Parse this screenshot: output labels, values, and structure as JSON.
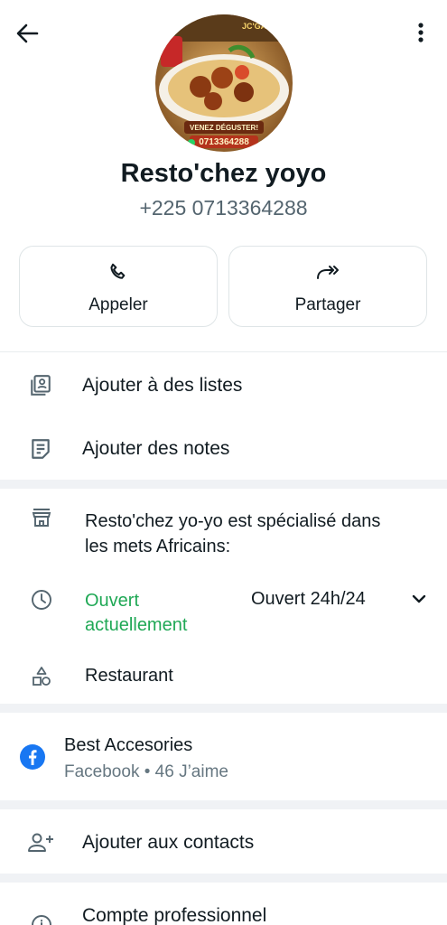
{
  "header": {
    "back_icon": "arrow-left-icon",
    "menu_icon": "more-vertical-icon"
  },
  "profile": {
    "avatar_text_1": "JC'GARBA",
    "avatar_text_2": "VENEZ DÉGUSTER!",
    "avatar_text_3": "0713364288",
    "name": "Resto'chez yoyo",
    "phone": "+225 0713364288"
  },
  "actions": [
    {
      "label": "Appeler",
      "icon": "phone-icon"
    },
    {
      "label": "Partager",
      "icon": "share-icon"
    }
  ],
  "list_actions": [
    {
      "label": "Ajouter à des listes",
      "icon": "list-icon"
    },
    {
      "label": "Ajouter des notes",
      "icon": "notes-icon"
    }
  ],
  "business": {
    "description_line1": "Resto'chez yo-yo est spécialisé dans",
    "description_line2": "les mets Africains:",
    "status_line1": "Ouvert",
    "status_line2": "actuellement",
    "hours": "Ouvert 24h/24",
    "category": "Restaurant"
  },
  "facebook": {
    "name": "Best Accesories",
    "sub": "Facebook • 46 J’aime"
  },
  "contacts": {
    "label": "Ajouter aux contacts"
  },
  "professional": {
    "label": "Compte professionnel"
  },
  "colors": {
    "accent_green": "#1fa855",
    "facebook_blue": "#1877f2"
  }
}
